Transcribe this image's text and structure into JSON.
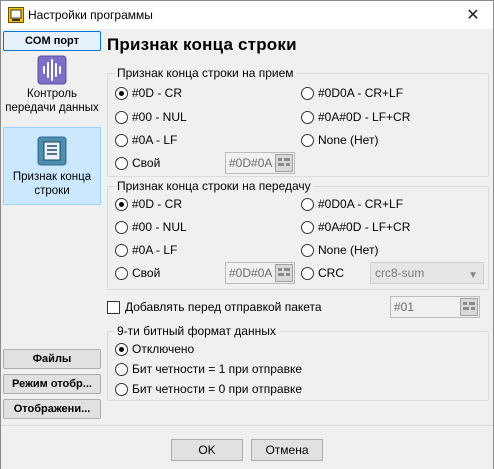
{
  "window": {
    "title": "Настройки программы"
  },
  "sidebar": {
    "top_button": "COM порт",
    "items": [
      {
        "label": "Контроль передачи данных",
        "icon": "audio-waveform-icon"
      },
      {
        "label": "Признак конца строки",
        "icon": "text-document-icon"
      }
    ],
    "bottom_buttons": [
      "Файлы",
      "Режим отобр...",
      "Отображени..."
    ]
  },
  "page": {
    "title": "Признак конца строки"
  },
  "receive": {
    "legend": "Признак конца строки на прием",
    "options": [
      "#0D - CR",
      "#0D0A - CR+LF",
      "#00 - NUL",
      "#0A#0D - LF+CR",
      "#0A - LF",
      "None (Нет)",
      "Свой"
    ],
    "selected": "#0D - CR",
    "custom_value": "#0D#0A"
  },
  "transmit": {
    "legend": "Признак конца строки на передачу",
    "options": [
      "#0D - CR",
      "#0D0A - CR+LF",
      "#00 - NUL",
      "#0A#0D - LF+CR",
      "#0A - LF",
      "None (Нет)",
      "Свой",
      "CRC"
    ],
    "selected": "#0D - CR",
    "custom_value": "#0D#0A",
    "crc_value": "crc8-sum"
  },
  "prefix": {
    "label": "Добавлять перед отправкой пакета",
    "checked": false,
    "value": "#01"
  },
  "ninebit": {
    "legend": "9-ти битный формат данных",
    "options": [
      "Отключено",
      "Бит четности = 1 при отправке",
      "Бит четности = 0 при отправке"
    ],
    "selected": "Отключено"
  },
  "footer": {
    "ok": "OK",
    "cancel": "Отмена"
  }
}
